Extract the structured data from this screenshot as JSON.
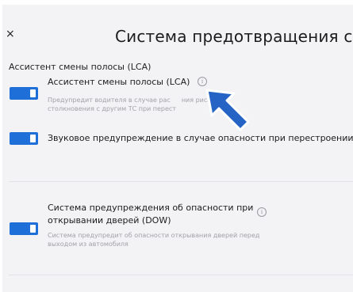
{
  "header": {
    "close_label": "×",
    "title": "Система предотвращения столкно"
  },
  "section": {
    "title": "Ассистент смены полосы (LCA)"
  },
  "items": [
    {
      "label": "Ассистент смены полосы (LCA)",
      "description_line1": "Предупредит водителя в случае рас",
      "description_line1_tail": "ния риска",
      "description_line2": "столкновения с другим ТС при перест",
      "info_icon": "info-icon",
      "toggle_on": true
    },
    {
      "label": "Звуковое предупреждение в случае опасности при перестроении",
      "toggle_on": true
    },
    {
      "label_line1": "Система предупреждения об опасности при",
      "label_line2": "открывании дверей (DOW)",
      "description_line1": "Система предупредит об опасности открывания дверей перед",
      "description_line2": "выходом из автомобиля",
      "info_icon": "info-icon",
      "toggle_on": true
    }
  ],
  "colors": {
    "accent": "#1e6fd8",
    "background": "#f3f3f6",
    "text": "#1c1c1c",
    "muted": "#a2a2a8"
  },
  "icons": {
    "close": "close-icon",
    "info": "info-icon",
    "pointer": "pointer-arrow-icon"
  }
}
